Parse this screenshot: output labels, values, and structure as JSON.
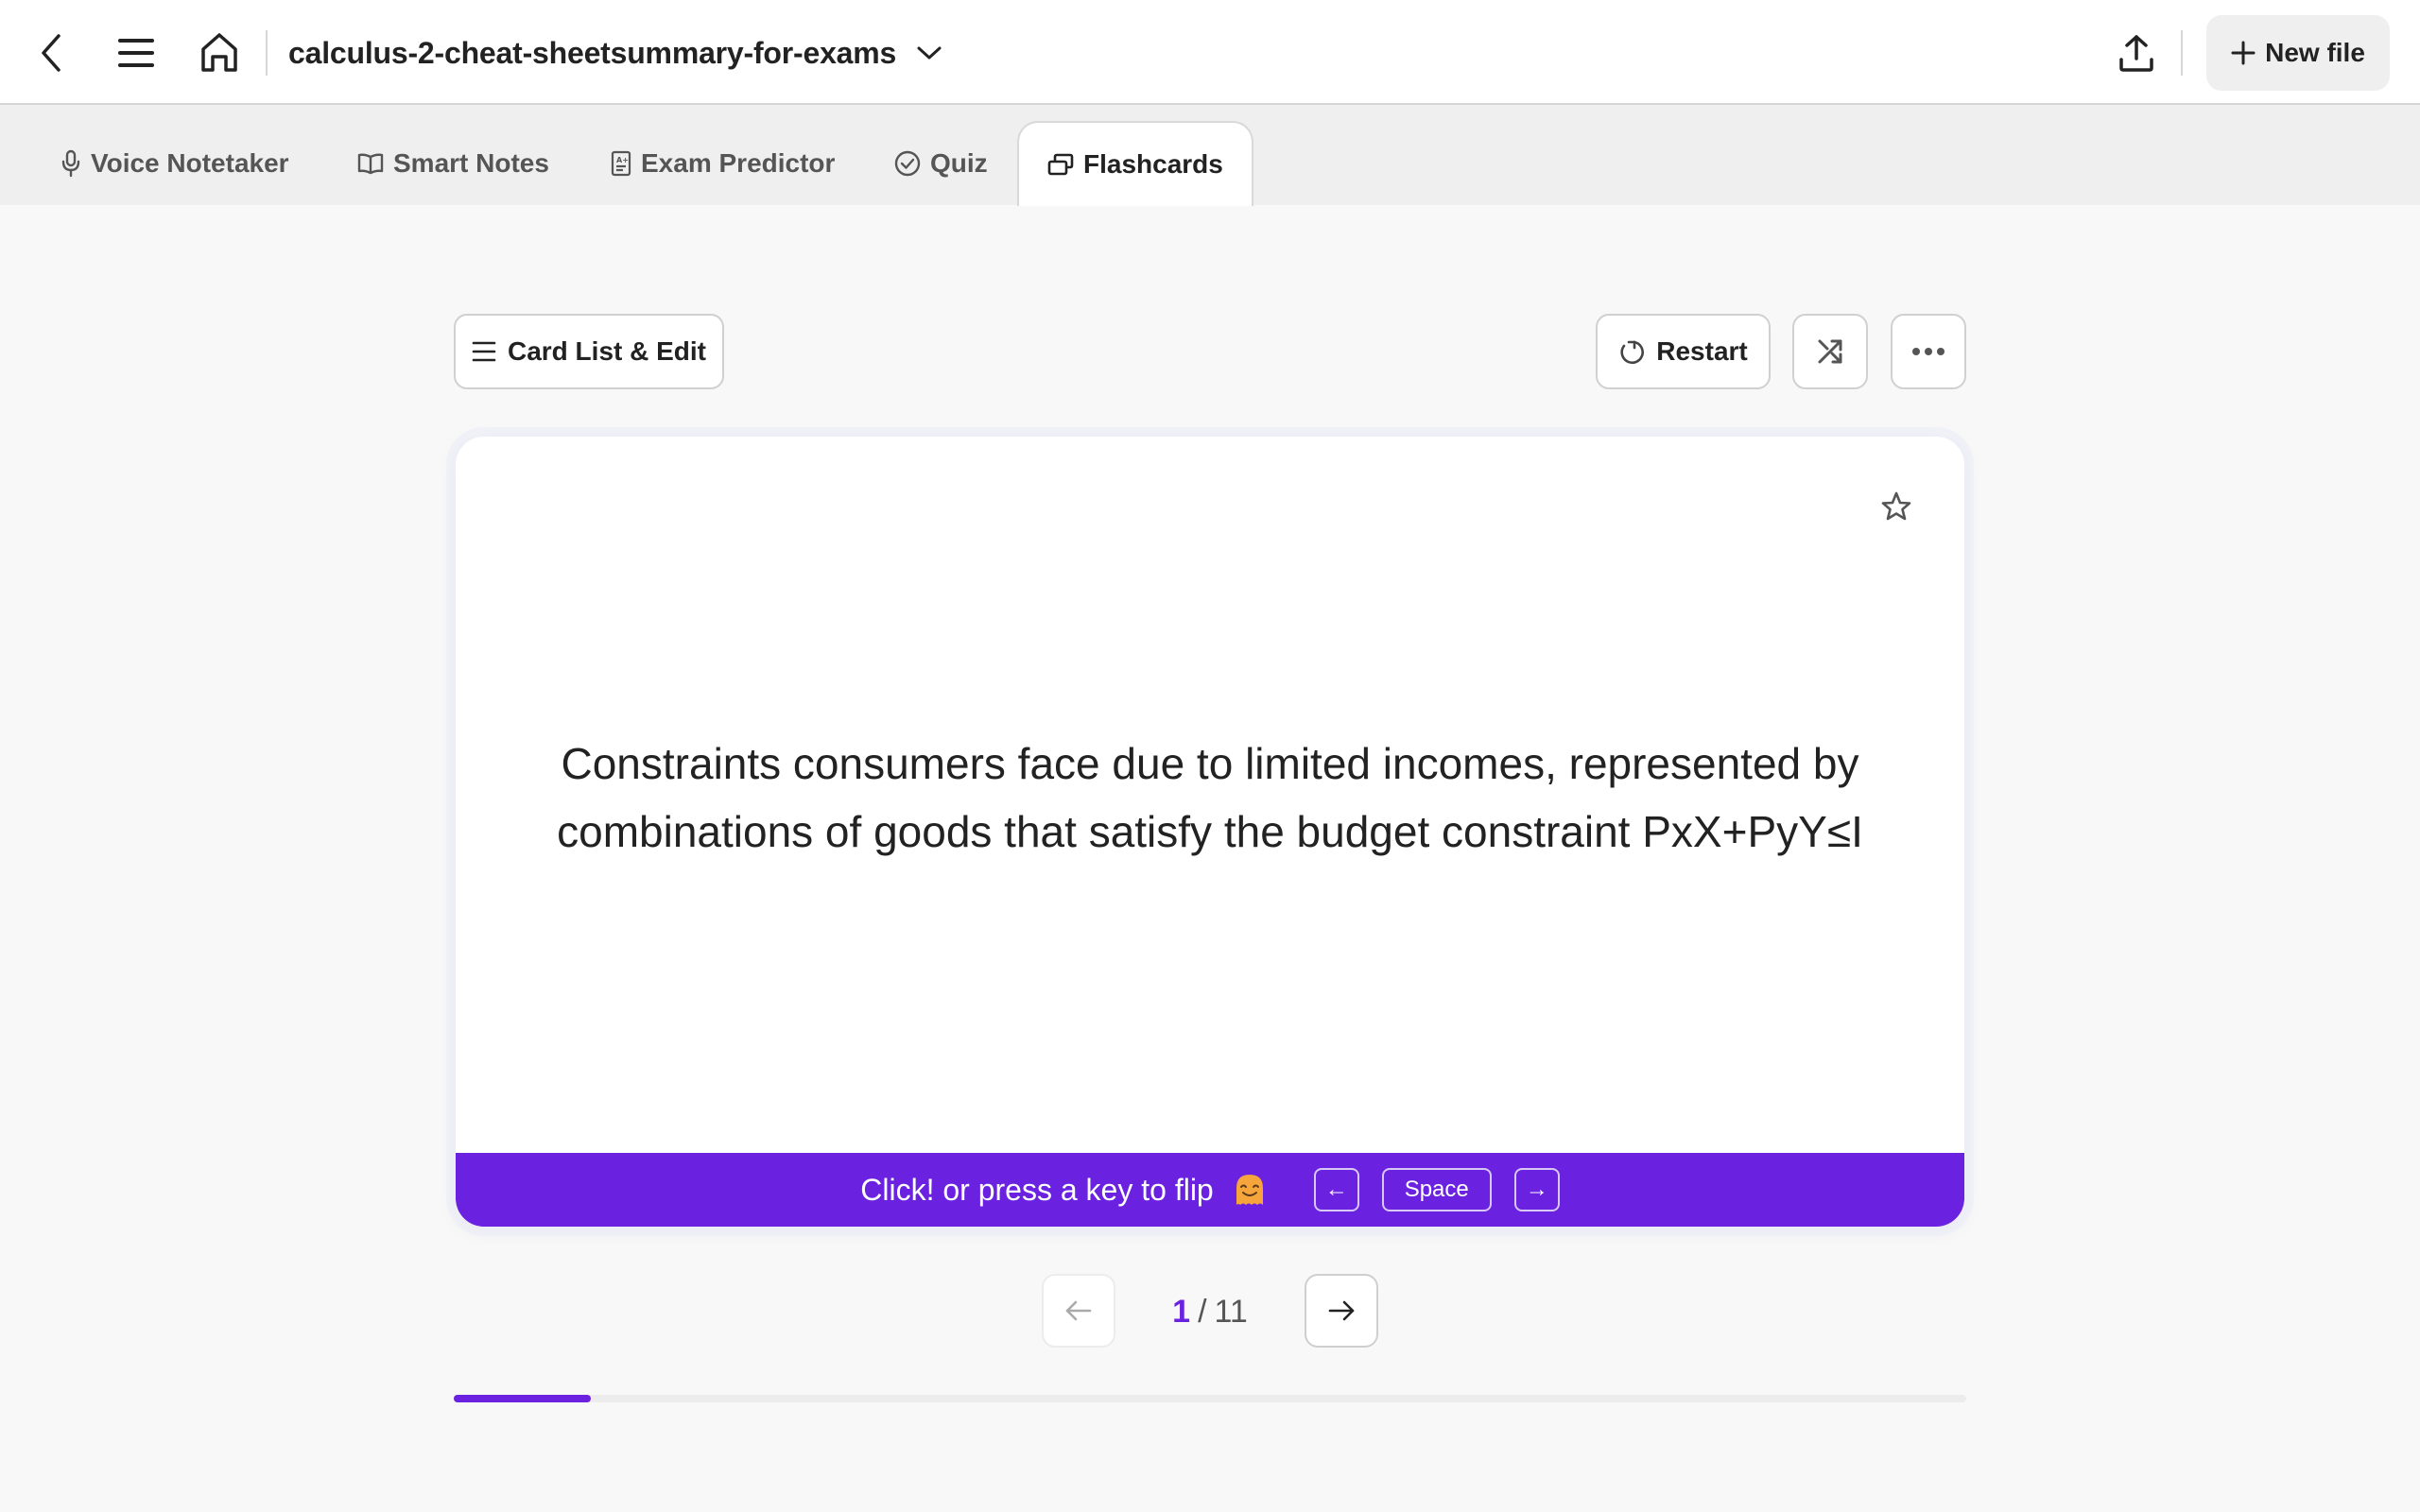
{
  "header": {
    "document_title": "calculus-2-cheat-sheetsummary-for-exams",
    "new_file_label": "New file",
    "icons": {
      "back": "chevron-left-icon",
      "menu": "hamburger-menu-icon",
      "home": "home-icon",
      "title_dropdown": "chevron-down-icon",
      "upload": "upload-icon",
      "new_file": "plus-icon"
    }
  },
  "tabs": [
    {
      "label": "Voice Notetaker",
      "icon": "microphone-icon",
      "active": false
    },
    {
      "label": "Smart Notes",
      "icon": "book-open-icon",
      "active": false
    },
    {
      "label": "Exam Predictor",
      "icon": "exam-sheet-icon",
      "active": false
    },
    {
      "label": "Quiz",
      "icon": "check-circle-icon",
      "active": false
    },
    {
      "label": "Flashcards",
      "icon": "cards-icon",
      "active": true
    }
  ],
  "toolbar": {
    "card_list_label": "Card List & Edit",
    "restart_label": "Restart",
    "shuffle_icon": "shuffle-icon",
    "more_icon": "more-horizontal-icon"
  },
  "card": {
    "text": "Constraints consumers face due to limited incomes, represented by combinations of goods that satisfy the budget constraint PxX+PyY≤I",
    "starred": false,
    "flip_hint": "Click! or press a key to flip",
    "hint_emoji": "smiling-ghost-emoji",
    "keys": {
      "left": "←",
      "space": "Space",
      "right": "→"
    }
  },
  "pagination": {
    "current": "1",
    "separator": "/",
    "total": "11",
    "prev_enabled": false,
    "next_enabled": true
  },
  "progress": {
    "fraction": 0.0909
  },
  "colors": {
    "accent": "#6b21e0",
    "tab_bar_bg": "#efefef",
    "page_bg": "#f8f8f8"
  }
}
